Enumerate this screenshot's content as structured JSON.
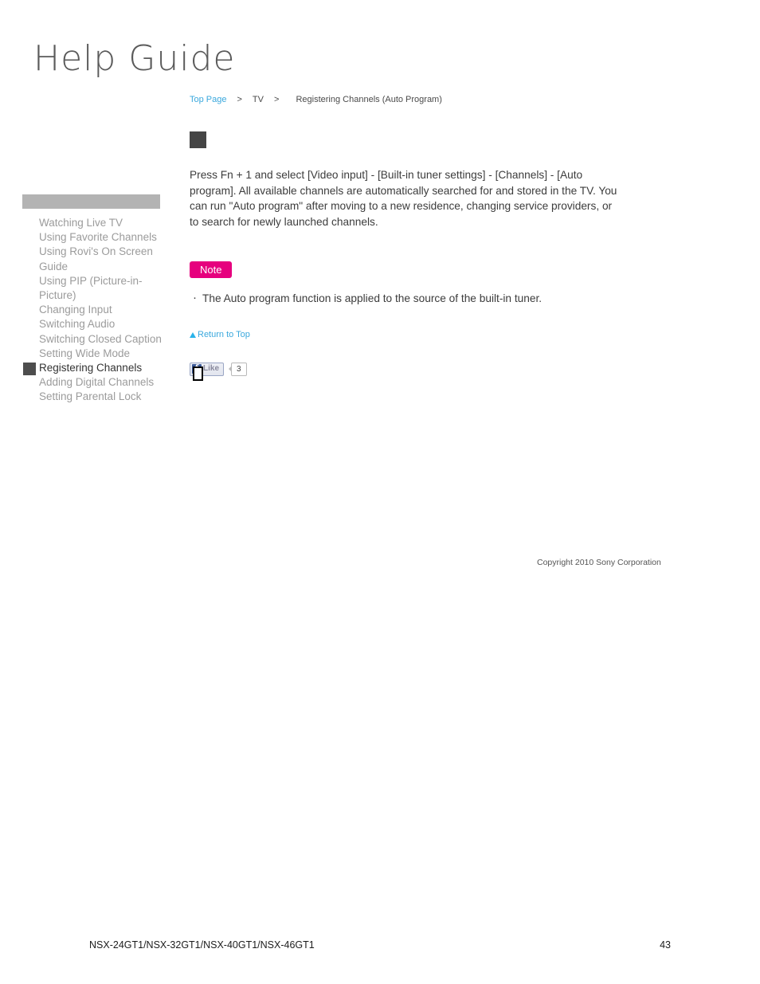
{
  "masthead": {
    "title": "Help Guide"
  },
  "breadcrumb": {
    "top_page": "Top Page",
    "separator": ">",
    "section": "TV",
    "current": "Registering Channels (Auto Program)"
  },
  "sidebar": {
    "items": [
      {
        "label": "Watching Live TV",
        "active": false
      },
      {
        "label": "Using Favorite Channels",
        "active": false
      },
      {
        "label": "Using Rovi's On Screen Guide",
        "active": false
      },
      {
        "label": "Using PIP (Picture-in-Picture)",
        "active": false
      },
      {
        "label": "Changing Input",
        "active": false
      },
      {
        "label": "Switching Audio",
        "active": false
      },
      {
        "label": "Switching Closed Caption",
        "active": false
      },
      {
        "label": "Setting Wide Mode",
        "active": false
      },
      {
        "label": "Registering Channels",
        "active": true
      },
      {
        "label": "Adding Digital Channels",
        "active": false
      },
      {
        "label": "Setting Parental Lock",
        "active": false
      }
    ]
  },
  "main": {
    "body_text": "Press Fn + 1 and select [Video input] - [Built-in tuner settings] - [Channels] - [Auto program]. All available channels are automatically searched for and stored in the TV. You can run \"Auto program\" after moving to a new residence, changing service providers, or to search for newly launched channels.",
    "note_label": "Note",
    "note_items": [
      "The Auto program function is applied to the source of the built-in tuner."
    ],
    "return_to_top": "Return to Top"
  },
  "social": {
    "facebook_glyph": "f",
    "like_label": "Like",
    "like_count": "3"
  },
  "copyright": "Copyright 2010 Sony Corporation",
  "footer": {
    "models": "NSX-24GT1/NSX-32GT1/NSX-40GT1/NSX-46GT1",
    "page_number": "43"
  },
  "colors": {
    "link": "#3aa8dd",
    "note_badge": "#e6007e",
    "facebook_blue": "#3b5998",
    "active_item": "#333333",
    "inactive_item": "#9b9b9b"
  }
}
